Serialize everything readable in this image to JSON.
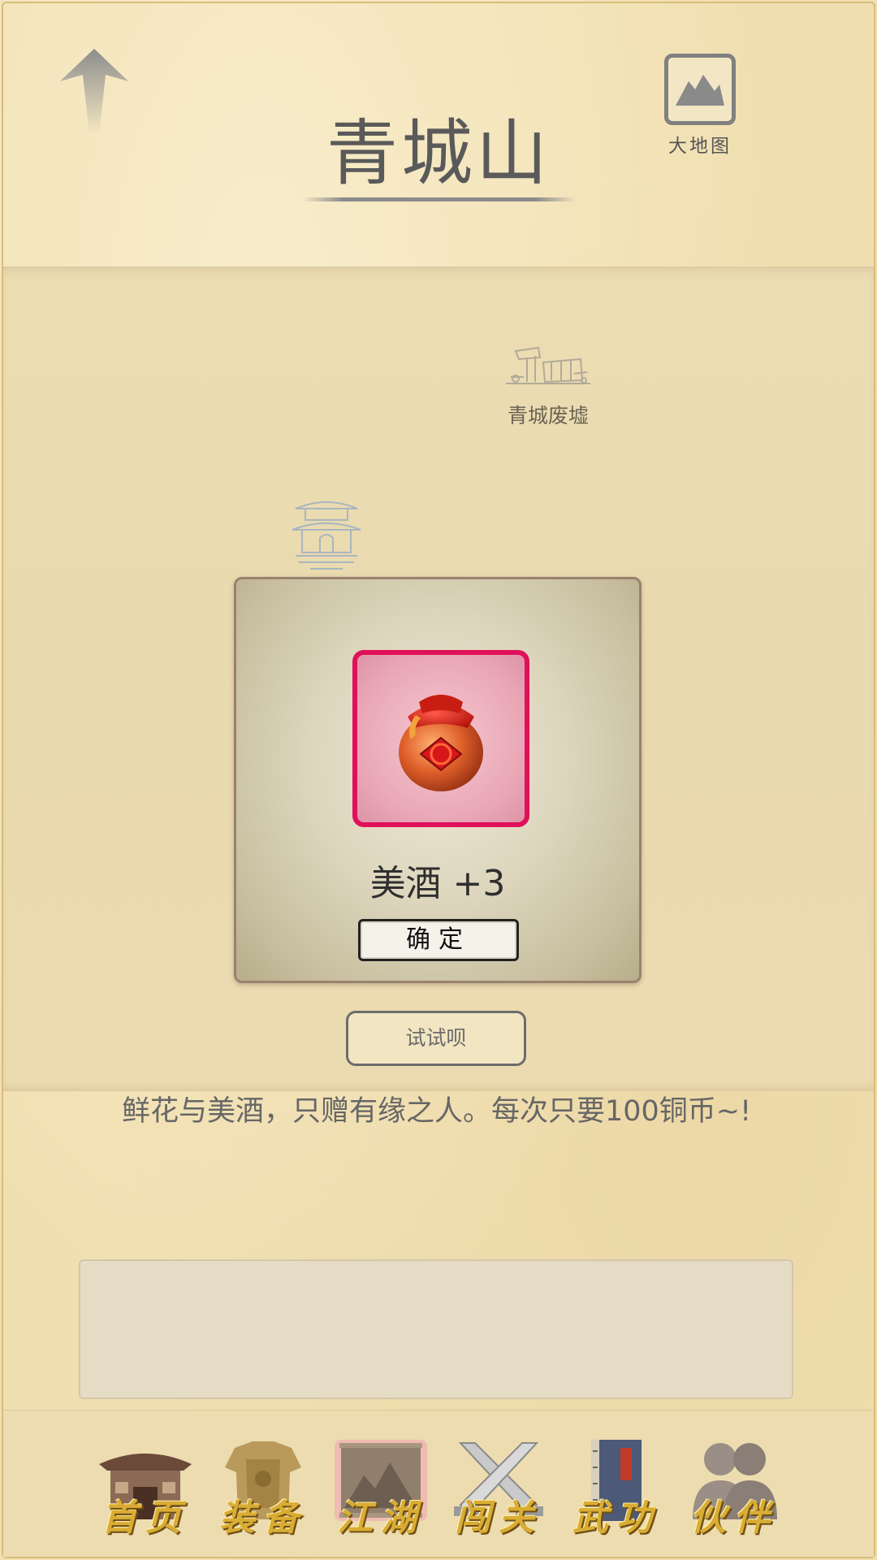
{
  "header": {
    "title": "青城山",
    "world_map_label": "大地图"
  },
  "map": {
    "locations": [
      {
        "name": "青城废墟",
        "icon": "ruins-icon"
      },
      {
        "name": "",
        "icon": "pagoda-icon"
      }
    ]
  },
  "popup": {
    "item_icon": "wine-jar-icon",
    "item_name": "美酒 +3",
    "confirm_label": "确定"
  },
  "actions": {
    "try_label": "试试呗"
  },
  "description": "鲜花与美酒，只赠有缘之人。每次只要100铜币~!",
  "log": {
    "text": ""
  },
  "bottom_nav": [
    {
      "label": "首页",
      "icon": "house-icon",
      "active": false
    },
    {
      "label": "装备",
      "icon": "armor-icon",
      "active": false
    },
    {
      "label": "江湖",
      "icon": "map-scroll-icon",
      "active": true
    },
    {
      "label": "闯关",
      "icon": "crossed-swords-icon",
      "active": false
    },
    {
      "label": "武功",
      "icon": "manual-book-icon",
      "active": false
    },
    {
      "label": "伙伴",
      "icon": "companions-icon",
      "active": false
    }
  ],
  "colors": {
    "background": "#f0dfb0",
    "popup_highlight": "#e0105a",
    "nav_label_gold": "#d9ad34"
  }
}
